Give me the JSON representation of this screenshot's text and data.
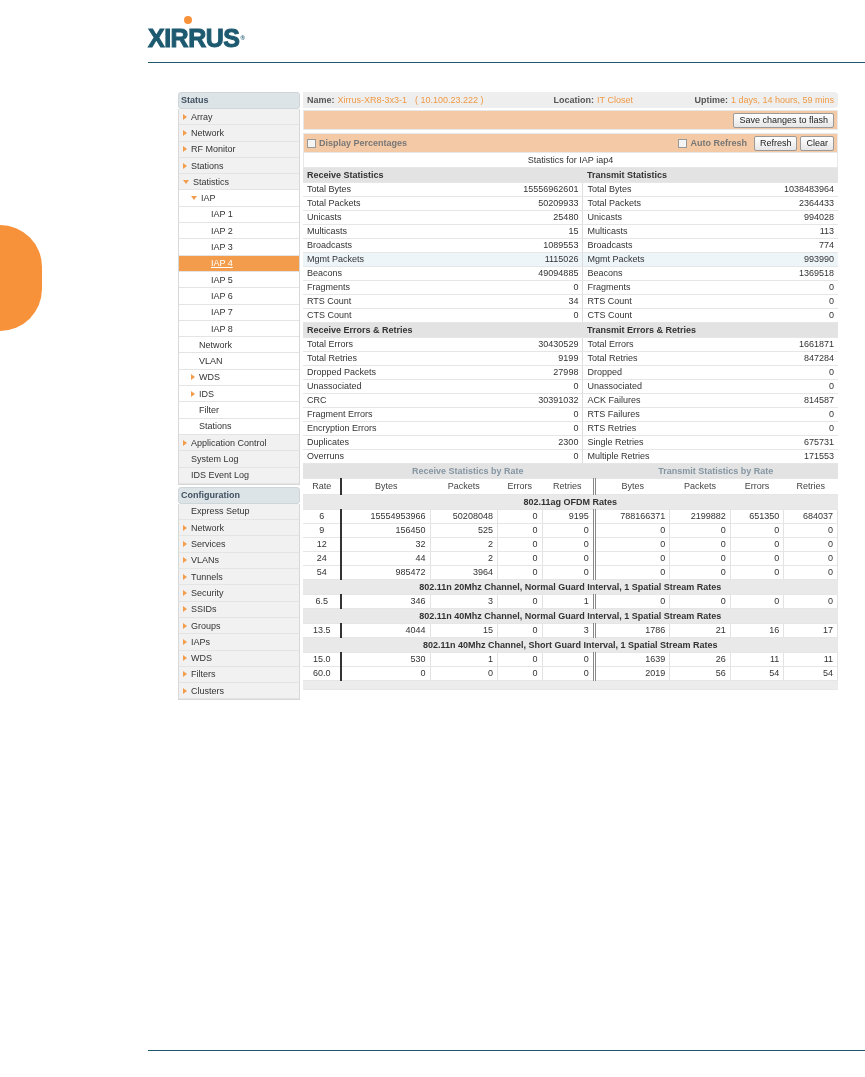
{
  "logo": {
    "text": "XIRRUS",
    "mark": "®"
  },
  "sidebar": [
    {
      "title": "Status",
      "items": [
        {
          "label": "Array",
          "expanded": false,
          "selected": false
        },
        {
          "label": "Network",
          "expanded": false,
          "selected": false
        },
        {
          "label": "RF Monitor",
          "expanded": false,
          "selected": false
        },
        {
          "label": "Stations",
          "expanded": false,
          "selected": false
        },
        {
          "label": "Statistics",
          "expanded": true,
          "selected": false,
          "children": [
            {
              "label": "IAP",
              "expanded": true,
              "selected": false,
              "children": [
                {
                  "label": "IAP 1",
                  "selected": false
                },
                {
                  "label": "IAP 2",
                  "selected": false
                },
                {
                  "label": "IAP 3",
                  "selected": false
                },
                {
                  "label": "IAP 4",
                  "selected": true
                },
                {
                  "label": "IAP 5",
                  "selected": false
                },
                {
                  "label": "IAP 6",
                  "selected": false
                },
                {
                  "label": "IAP 7",
                  "selected": false
                },
                {
                  "label": "IAP 8",
                  "selected": false
                }
              ]
            },
            {
              "label": "Network",
              "selected": false
            },
            {
              "label": "VLAN",
              "selected": false
            },
            {
              "label": "WDS",
              "expanded": false,
              "selected": false
            },
            {
              "label": "IDS",
              "expanded": false,
              "selected": false
            },
            {
              "label": "Filter",
              "selected": false
            },
            {
              "label": "Stations",
              "selected": false
            }
          ]
        },
        {
          "label": "Application Control",
          "expanded": false,
          "selected": false
        },
        {
          "label": "System Log",
          "selected": false
        },
        {
          "label": "IDS Event Log",
          "selected": false
        }
      ]
    },
    {
      "title": "Configuration",
      "items": [
        {
          "label": "Express Setup",
          "selected": false
        },
        {
          "label": "Network",
          "expanded": false,
          "selected": false
        },
        {
          "label": "Services",
          "expanded": false,
          "selected": false
        },
        {
          "label": "VLANs",
          "expanded": false,
          "selected": false
        },
        {
          "label": "Tunnels",
          "expanded": false,
          "selected": false
        },
        {
          "label": "Security",
          "expanded": false,
          "selected": false
        },
        {
          "label": "SSIDs",
          "expanded": false,
          "selected": false
        },
        {
          "label": "Groups",
          "expanded": false,
          "selected": false
        },
        {
          "label": "IAPs",
          "expanded": false,
          "selected": false
        },
        {
          "label": "WDS",
          "expanded": false,
          "selected": false
        },
        {
          "label": "Filters",
          "expanded": false,
          "selected": false
        },
        {
          "label": "Clusters",
          "expanded": false,
          "selected": false
        }
      ]
    }
  ],
  "info_bar": {
    "name_label": "Name:",
    "name": "Xirrus-XR8-3x3-1",
    "address": "( 10.100.23.222 )",
    "location_label": "Location:",
    "location": "IT Closet",
    "uptime_label": "Uptime:",
    "uptime": "1 days, 14 hours, 59 mins"
  },
  "save_button": "Save changes to flash",
  "display_percentages": {
    "label": "Display Percentages",
    "checked": false
  },
  "auto_refresh": {
    "label": "Auto Refresh",
    "checked": false
  },
  "buttons": [
    "Refresh",
    "Clear"
  ],
  "stats_title": "Statistics for IAP iap4",
  "sections": [
    {
      "rx_title": "Receive Statistics",
      "tx_title": "Transmit Statistics",
      "rows": [
        {
          "rx_label": "Total Bytes",
          "rx_value": "15556962601",
          "tx_label": "Total Bytes",
          "tx_value": "1038483964",
          "highlighted": false
        },
        {
          "rx_label": "Total Packets",
          "rx_value": "50209933",
          "tx_label": "Total Packets",
          "tx_value": "2364433",
          "highlighted": false
        },
        {
          "rx_label": "Unicasts",
          "rx_value": "25480",
          "tx_label": "Unicasts",
          "tx_value": "994028",
          "highlighted": false
        },
        {
          "rx_label": "Multicasts",
          "rx_value": "15",
          "tx_label": "Multicasts",
          "tx_value": "113",
          "highlighted": false
        },
        {
          "rx_label": "Broadcasts",
          "rx_value": "1089553",
          "tx_label": "Broadcasts",
          "tx_value": "774",
          "highlighted": false
        },
        {
          "rx_label": "Mgmt Packets",
          "rx_value": "1115026",
          "tx_label": "Mgmt Packets",
          "tx_value": "993990",
          "highlighted": true
        },
        {
          "rx_label": "Beacons",
          "rx_value": "49094885",
          "tx_label": "Beacons",
          "tx_value": "1369518",
          "highlighted": false
        },
        {
          "rx_label": "Fragments",
          "rx_value": "0",
          "tx_label": "Fragments",
          "tx_value": "0",
          "highlighted": false
        },
        {
          "rx_label": "RTS Count",
          "rx_value": "34",
          "tx_label": "RTS Count",
          "tx_value": "0",
          "highlighted": false
        },
        {
          "rx_label": "CTS Count",
          "rx_value": "0",
          "tx_label": "CTS Count",
          "tx_value": "0",
          "highlighted": false
        }
      ]
    },
    {
      "rx_title": "Receive Errors & Retries",
      "tx_title": "Transmit Errors & Retries",
      "rows": [
        {
          "rx_label": "Total Errors",
          "rx_value": "30430529",
          "tx_label": "Total Errors",
          "tx_value": "1661871",
          "highlighted": false
        },
        {
          "rx_label": "Total Retries",
          "rx_value": "9199",
          "tx_label": "Total Retries",
          "tx_value": "847284",
          "highlighted": false
        },
        {
          "rx_label": "Dropped Packets",
          "rx_value": "27998",
          "tx_label": "Dropped",
          "tx_value": "0",
          "highlighted": false
        },
        {
          "rx_label": "Unassociated",
          "rx_value": "0",
          "tx_label": "Unassociated",
          "tx_value": "0",
          "highlighted": false
        },
        {
          "rx_label": "CRC",
          "rx_value": "30391032",
          "tx_label": "ACK Failures",
          "tx_value": "814587",
          "highlighted": false
        },
        {
          "rx_label": "Fragment Errors",
          "rx_value": "0",
          "tx_label": "RTS Failures",
          "tx_value": "0",
          "highlighted": false
        },
        {
          "rx_label": "Encryption Errors",
          "rx_value": "0",
          "tx_label": "RTS Retries",
          "tx_value": "0",
          "highlighted": false
        },
        {
          "rx_label": "Duplicates",
          "rx_value": "2300",
          "tx_label": "Single Retries",
          "tx_value": "675731",
          "highlighted": false
        },
        {
          "rx_label": "Overruns",
          "rx_value": "0",
          "tx_label": "Multiple Retries",
          "tx_value": "171553",
          "highlighted": false
        }
      ]
    }
  ],
  "rate_table": {
    "rx_title": "Receive Statistics by Rate",
    "tx_title": "Transmit Statistics by Rate",
    "columns": [
      "Rate",
      "Bytes",
      "Packets",
      "Errors",
      "Retries",
      "Bytes",
      "Packets",
      "Errors",
      "Retries"
    ],
    "groups": [
      {
        "title": "802.11ag OFDM Rates",
        "rows": [
          [
            "6",
            "15554953966",
            "50208048",
            "0",
            "9195",
            "788166371",
            "2199882",
            "651350",
            "684037"
          ],
          [
            "9",
            "156450",
            "525",
            "0",
            "0",
            "0",
            "0",
            "0",
            "0"
          ],
          [
            "12",
            "32",
            "2",
            "0",
            "0",
            "0",
            "0",
            "0",
            "0"
          ],
          [
            "24",
            "44",
            "2",
            "0",
            "0",
            "0",
            "0",
            "0",
            "0"
          ],
          [
            "54",
            "985472",
            "3964",
            "0",
            "0",
            "0",
            "0",
            "0",
            "0"
          ]
        ]
      },
      {
        "title": "802.11n 20Mhz Channel, Normal Guard Interval, 1 Spatial Stream Rates",
        "rows": [
          [
            "6.5",
            "346",
            "3",
            "0",
            "1",
            "0",
            "0",
            "0",
            "0"
          ]
        ]
      },
      {
        "title": "802.11n 40Mhz Channel, Normal Guard Interval, 1 Spatial Stream Rates",
        "rows": [
          [
            "13.5",
            "4044",
            "15",
            "0",
            "3",
            "1786",
            "21",
            "16",
            "17"
          ]
        ]
      },
      {
        "title": "802.11n 40Mhz Channel, Short Guard Interval, 1 Spatial Stream Rates",
        "rows": [
          [
            "15.0",
            "530",
            "1",
            "0",
            "0",
            "1639",
            "26",
            "11",
            "11"
          ],
          [
            "60.0",
            "0",
            "0",
            "0",
            "0",
            "2019",
            "56",
            "54",
            "54"
          ]
        ]
      }
    ]
  }
}
